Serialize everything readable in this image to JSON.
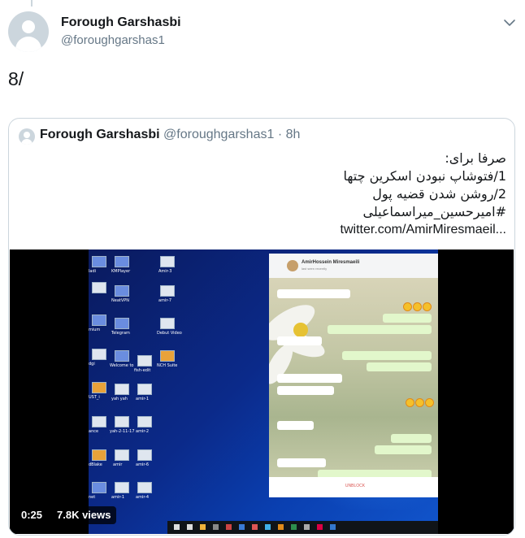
{
  "tweet": {
    "display_name": "Forough Garshasbi",
    "handle": "@foroughgarshas1",
    "text": "8/",
    "avatar_icon": "default-profile-avatar",
    "menu_icon": "chevron-down-icon"
  },
  "quoted_tweet": {
    "display_name": "Forough Garshasbi",
    "handle": "@foroughgarshas1",
    "separator": "·",
    "time": "8h",
    "lines": [
      "صرفا برای:",
      "1/فتوشاپ نبودن اسکرین چتها",
      "2/روشن شدن قضیه پول",
      "#امیرحسین_میراسماعیلی"
    ],
    "link": "twitter.com/AmirMiresmaeil..."
  },
  "video": {
    "duration": "0:25",
    "views": "7.8K views"
  },
  "colors": {
    "text_primary": "#14171a",
    "text_secondary": "#657786",
    "border": "#ccd6dd"
  }
}
